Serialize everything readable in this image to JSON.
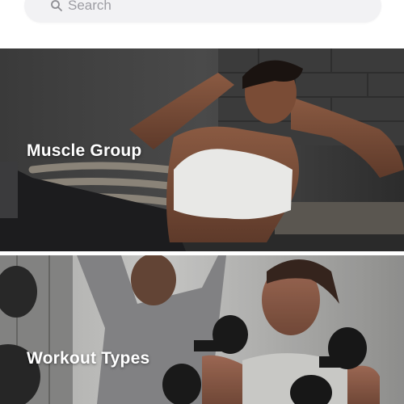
{
  "search": {
    "placeholder": "Search",
    "icon": "search-icon"
  },
  "categories": [
    {
      "label": "Muscle Group"
    },
    {
      "label": "Workout Types"
    }
  ],
  "colors": {
    "search_background": "#f2f2f4",
    "placeholder_text": "#9d9da3",
    "label_text": "#ffffff"
  }
}
